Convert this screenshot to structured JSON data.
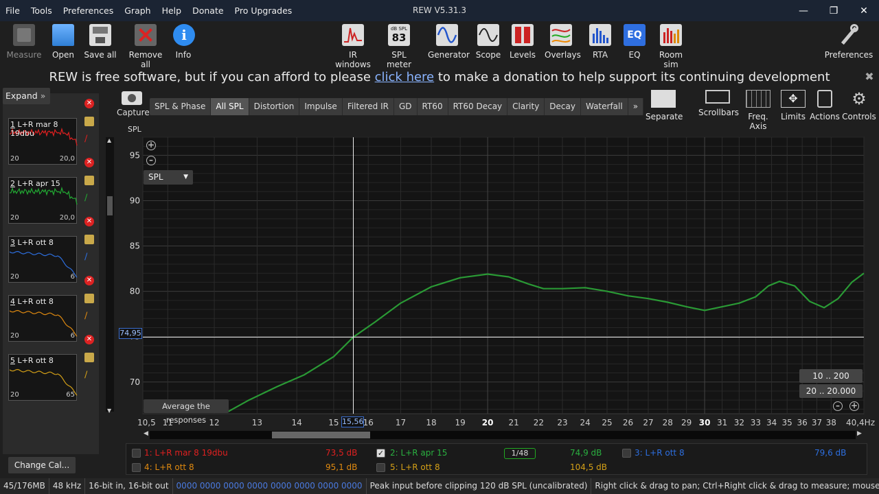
{
  "menu": [
    "File",
    "Tools",
    "Preferences",
    "Graph",
    "Help",
    "Donate",
    "Pro Upgrades"
  ],
  "window_title": "REW V5.31.3",
  "toolbar": {
    "measure": "Measure",
    "open": "Open",
    "save_all": "Save all",
    "remove_all": "Remove all",
    "info": "Info",
    "ir_windows": "IR windows",
    "spl_meter": "SPL meter",
    "spl_meter_display": {
      "unit": "dB SPL",
      "value": "83"
    },
    "generator": "Generator",
    "scope": "Scope",
    "levels": "Levels",
    "overlays": "Overlays",
    "rta": "RTA",
    "eq": "EQ",
    "eq_icon_text": "EQ",
    "room_sim": "Room sim",
    "preferences": "Preferences"
  },
  "banner": {
    "before": "REW is free software, but if you can afford to please ",
    "link": "click here",
    "after": " to make a donation to help support its continuing development"
  },
  "left_panel": {
    "expand": "Expand",
    "measurements": [
      {
        "num": "1",
        "name": " L+R mar 8 19dbu",
        "ax_left": "20",
        "ax_right": "20,0",
        "color": "#e02020"
      },
      {
        "num": "2",
        "name": " L+R apr 15",
        "ax_left": "20",
        "ax_right": "20,0",
        "color": "#22aa33"
      },
      {
        "num": "3",
        "name": " L+R ott 8",
        "ax_left": "20",
        "ax_right": "6",
        "color": "#2d6fe0"
      },
      {
        "num": "4",
        "name": " L+R ott 8",
        "ax_left": "20",
        "ax_right": "6",
        "color": "#e08a10"
      },
      {
        "num": "5",
        "name": " L+R ott 8",
        "ax_left": "20",
        "ax_right": "65",
        "color": "#d4a017"
      }
    ],
    "change_cal": "Change Cal..."
  },
  "capture": "Capture",
  "tabs": [
    "SPL & Phase",
    "All SPL",
    "Distortion",
    "Impulse",
    "Filtered IR",
    "GD",
    "RT60",
    "RT60 Decay",
    "Clarity",
    "Decay",
    "Waterfall",
    "»"
  ],
  "active_tab": "All SPL",
  "right_tools": {
    "separate": "Separate",
    "scrollbars": "Scrollbars",
    "freq_axis": "Freq. Axis",
    "limits": "Limits",
    "actions": "Actions",
    "controls": "Controls"
  },
  "graph": {
    "y_unit": "SPL",
    "dropdown": "SPL",
    "average_btn": "Average the responses",
    "cursor_y": "74,95",
    "cursor_x": "15,56",
    "range_10_200": "10 .. 200",
    "range_20_20000": "20 .. 20.000"
  },
  "chart_data": {
    "type": "line",
    "title": "",
    "xlabel": "",
    "ylabel": "SPL",
    "x_scale": "log",
    "xlim": [
      10.5,
      40.4
    ],
    "ylim": [
      66.5,
      97
    ],
    "grid": true,
    "y_ticks": [
      "95",
      "90",
      "85",
      "80",
      "75",
      "70"
    ],
    "y_tick_values": [
      95,
      90,
      85,
      80,
      75,
      70
    ],
    "x_ticks": [
      {
        "v": 10.5,
        "t": "10,5"
      },
      {
        "v": 11,
        "t": "11"
      },
      {
        "v": 12,
        "t": "12"
      },
      {
        "v": 13,
        "t": "13"
      },
      {
        "v": 14,
        "t": "14"
      },
      {
        "v": 15,
        "t": "15"
      },
      {
        "v": 16,
        "t": "16"
      },
      {
        "v": 17,
        "t": "17"
      },
      {
        "v": 18,
        "t": "18"
      },
      {
        "v": 19,
        "t": "19"
      },
      {
        "v": 20,
        "t": "20",
        "major": true
      },
      {
        "v": 21,
        "t": "21"
      },
      {
        "v": 22,
        "t": "22"
      },
      {
        "v": 23,
        "t": "23"
      },
      {
        "v": 24,
        "t": "24"
      },
      {
        "v": 25,
        "t": "25"
      },
      {
        "v": 26,
        "t": "26"
      },
      {
        "v": 27,
        "t": "27"
      },
      {
        "v": 28,
        "t": "28"
      },
      {
        "v": 29,
        "t": "29"
      },
      {
        "v": 30,
        "t": "30",
        "major": true
      },
      {
        "v": 31,
        "t": "31"
      },
      {
        "v": 32,
        "t": "32"
      },
      {
        "v": 33,
        "t": "33"
      },
      {
        "v": 34,
        "t": "34"
      },
      {
        "v": 35,
        "t": "35"
      },
      {
        "v": 36,
        "t": "36"
      },
      {
        "v": 37,
        "t": "37"
      },
      {
        "v": 38,
        "t": "38"
      },
      {
        "v": 40.4,
        "t": "40,4Hz"
      }
    ],
    "cursor": {
      "x": 15.56,
      "y": 74.95
    },
    "series": [
      {
        "color": "#2a9a35",
        "x": [
          12.3,
          12.8,
          13.5,
          14.2,
          15.0,
          15.56,
          16.2,
          17.0,
          18.0,
          19.0,
          20.0,
          20.8,
          21.6,
          22.2,
          23.0,
          24.0,
          25.0,
          26.0,
          27.0,
          28.0,
          29.0,
          30.0,
          31.0,
          32.0,
          33.0,
          33.8,
          34.5,
          35.5,
          36.5,
          37.5,
          38.5,
          39.5,
          40.4
        ],
        "y": [
          66.7,
          68.0,
          69.5,
          70.8,
          72.8,
          74.95,
          76.6,
          78.7,
          80.5,
          81.5,
          81.9,
          81.6,
          80.8,
          80.3,
          80.3,
          80.4,
          80.0,
          79.5,
          79.2,
          78.8,
          78.3,
          77.9,
          78.3,
          78.7,
          79.4,
          80.6,
          81.1,
          80.6,
          78.9,
          78.2,
          79.2,
          81.0,
          82.0
        ]
      }
    ]
  },
  "legend": [
    {
      "label": "1: L+R mar 8 19dbu",
      "value": "73,5 dB",
      "color": "#e02020",
      "checked": false
    },
    {
      "label": "2: L+R apr 15",
      "value": "74,9 dB",
      "color": "#2ab040",
      "checked": true
    },
    {
      "label": "3: L+R ott 8",
      "value": "79,6 dB",
      "color": "#2d6fe0",
      "checked": false
    },
    {
      "label": "4: L+R ott 8",
      "value": "95,1 dB",
      "color": "#e08a10",
      "checked": false
    },
    {
      "label": "5: L+R ott 8",
      "value": "104,5 dB",
      "color": "#d4a017",
      "checked": false
    }
  ],
  "smoothing": "1/48",
  "status": {
    "memory": "45/176MB",
    "rate": "48 kHz",
    "bits": "16-bit in, 16-bit out",
    "levels": "0000 0000  0000 0000  0000 0000  0000 0000",
    "peak": "Peak input before clipping 120 dB SPL (uncalibrated)",
    "hint": "Right click & drag to pan; Ctrl+Right click & drag to measure; mouse wheel to zoom;"
  }
}
